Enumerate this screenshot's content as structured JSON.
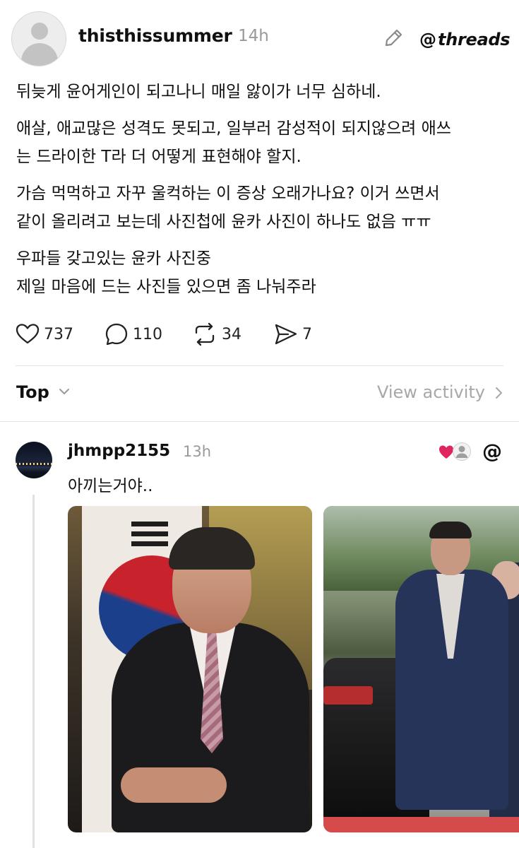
{
  "post": {
    "username": "thisthissummer",
    "time": "14h",
    "brand": "threads",
    "paragraphs": [
      "뒤늦게 윤어게인이 되고나니 매일 앓이가 너무 심하네.",
      "애살, 애교많은 성격도 못되고, 일부러 감성적이 되지않으려 애쓰\n는 드라이한 T라 더 어떻게 표현해야 할지.",
      "가슴 먹먹하고 자꾸 울컥하는 이 증상 오래가나요? 이거 쓰면서\n같이 올리려고 보는데 사진첩에 윤카 사진이 하나도 없음 ㅠㅠ",
      "우파들 갖고있는 윤카 사진중\n제일 마음에 드는 사진들 있으면 좀 나눠주라"
    ],
    "likes": "737",
    "replies": "110",
    "reposts": "34",
    "shares": "7"
  },
  "sort": {
    "label": "Top",
    "view_activity": "View activity"
  },
  "reply": {
    "username": "jhmpp2155",
    "time": "13h",
    "text": "아끼는거야.."
  },
  "colors": {
    "like_heart": "#e0245e",
    "muted_text": "#999999",
    "divider": "#e3e3e3"
  },
  "icons": [
    "edit-icon",
    "threads-logo-icon",
    "heart-icon",
    "comment-icon",
    "repost-icon",
    "share-icon",
    "chevron-down-icon",
    "chevron-right-icon"
  ]
}
